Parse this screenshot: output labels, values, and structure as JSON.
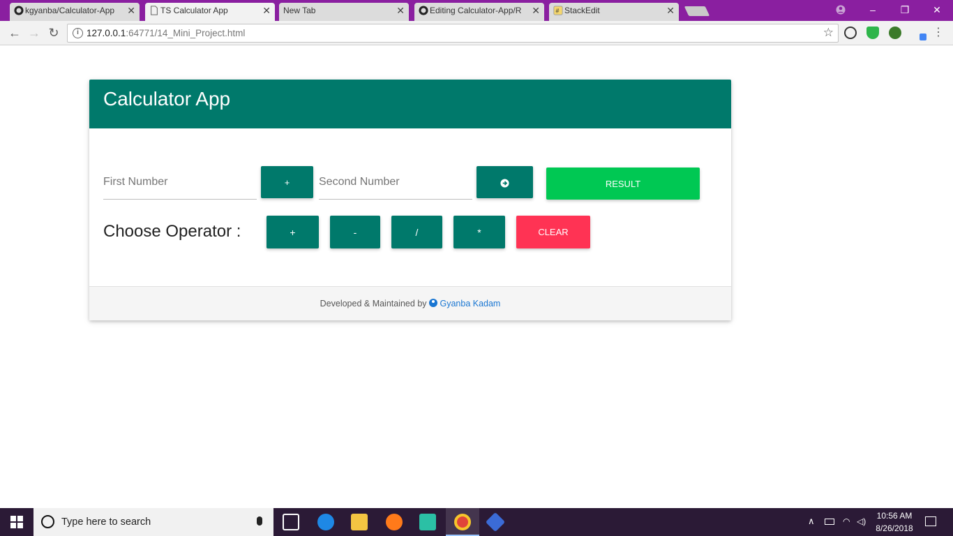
{
  "browser": {
    "tabs": [
      {
        "title": "kgyanba/Calculator-App",
        "active": false
      },
      {
        "title": "TS Calculator App",
        "active": true
      },
      {
        "title": "New Tab",
        "active": false
      },
      {
        "title": "Editing Calculator-App/R",
        "active": false
      },
      {
        "title": "StackEdit",
        "active": false
      }
    ],
    "url_host": "127.0.0.1",
    "url_rest": ":64771/14_Mini_Project.html",
    "accent_color": "#8a1fa0"
  },
  "app": {
    "title": "Calculator App",
    "first_number_placeholder": "First Number",
    "second_number_placeholder": "Second Number",
    "selected_operator": "+",
    "result_label": "RESULT",
    "choose_operator_label": "Choose Operator :",
    "operators": [
      "+",
      "-",
      "/",
      "*"
    ],
    "clear_label": "CLEAR",
    "footer_text": "Developed & Maintained by",
    "author": "Gyanba Kadam",
    "colors": {
      "header": "#00796b",
      "result": "#00c853",
      "clear": "#ff3354"
    }
  },
  "taskbar": {
    "search_placeholder": "Type here to search",
    "time": "10:56 AM",
    "date": "8/26/2018"
  }
}
